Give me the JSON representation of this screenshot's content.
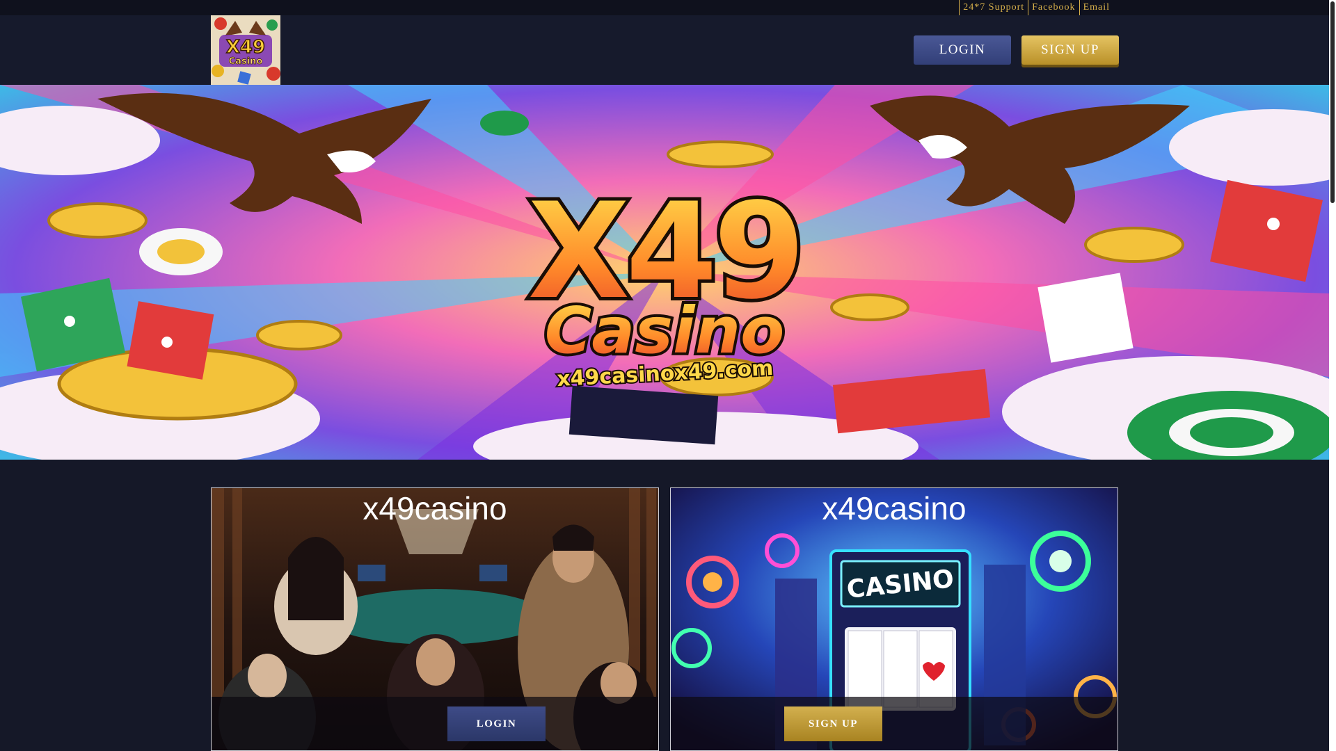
{
  "topbar": {
    "links": [
      "24*7 Support",
      "Facebook",
      "Email"
    ]
  },
  "header": {
    "logo_line1": "X49",
    "logo_line2": "Casino",
    "login_label": "LOGIN",
    "signup_label": "SIGN UP"
  },
  "banner": {
    "title": "X49",
    "subtitle": "Casino",
    "url": "x49casinox49.com"
  },
  "cards": {
    "left": {
      "title": "x49casino",
      "button_label": "LOGIN"
    },
    "right": {
      "title": "x49casino",
      "sign_text": "CASINO",
      "button_label": "SIGN UP"
    }
  },
  "colors": {
    "page_bg": "#151828",
    "gold": "#d9b24c",
    "login_blue": "#3e4b87"
  },
  "icons": {
    "eagle": "eagle-illustration",
    "coin": "gold-coin",
    "die": "red-die",
    "chip": "casino-chip",
    "slot": "slot-machine"
  }
}
